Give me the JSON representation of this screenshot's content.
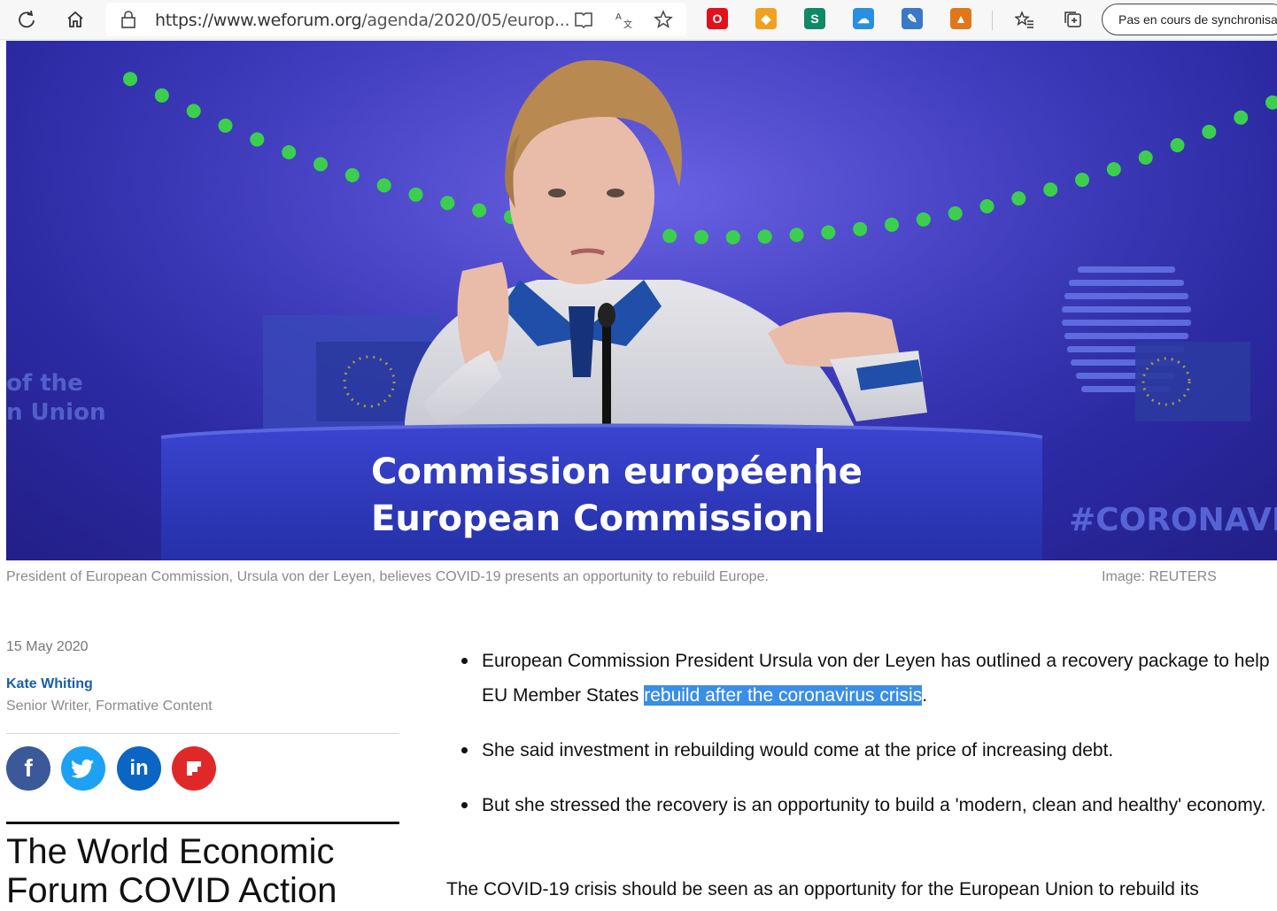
{
  "browser": {
    "url_main": "https://www.weforum.org",
    "url_path": "/agenda/2020/05/europ...",
    "sync_label": "Pas en cours de synchronisation",
    "extensions": [
      {
        "name": "opera-icon",
        "color": "#e0121b",
        "glyph": "O"
      },
      {
        "name": "fish-icon",
        "color": "#f2a020",
        "glyph": "◆"
      },
      {
        "name": "s-extension-icon",
        "color": "#0f8a66",
        "glyph": "S"
      },
      {
        "name": "cloud-icon",
        "color": "#2a8fe0",
        "glyph": "☁"
      },
      {
        "name": "feather-icon",
        "color": "#3a78c8",
        "glyph": "✎"
      },
      {
        "name": "metamask-icon",
        "color": "#e2761b",
        "glyph": "▲"
      }
    ]
  },
  "hero": {
    "line1": "Commission européenne",
    "line2": "European Commission",
    "left_text1": "of the",
    "left_text2": "n Union",
    "right_text": "#CORONAVI"
  },
  "caption": "President of European Commission, Ursula von der Leyen, believes COVID-19 presents an opportunity to rebuild Europe.",
  "credit": "Image: REUTERS",
  "article": {
    "date": "15 May 2020",
    "author": "Kate Whiting",
    "author_role": "Senior Writer, Formative Content",
    "share": [
      {
        "name": "facebook-share-button",
        "label": "f",
        "color": "#3b5998"
      },
      {
        "name": "twitter-share-button",
        "label": "🐦",
        "color": "#1da1f2"
      },
      {
        "name": "linkedin-share-button",
        "label": "in",
        "color": "#0a66c2"
      },
      {
        "name": "flipboard-share-button",
        "label": "F",
        "color": "#e12828"
      }
    ],
    "section_title": "The World Economic Forum COVID Action",
    "bullet1_before": "European Commission President Ursula von der Leyen has outlined a recovery package to help EU Member States ",
    "bullet1_link": "rebuild after the coronavirus crisis",
    "bullet1_after": ".",
    "bullet2": "She said investment in rebuilding would come at the price of increasing debt.",
    "bullet3": "But she stressed the recovery is an opportunity to build a 'modern, clean and healthy' economy.",
    "paragraph": "The COVID-19 crisis should be seen as an opportunity for the European Union to rebuild its"
  }
}
